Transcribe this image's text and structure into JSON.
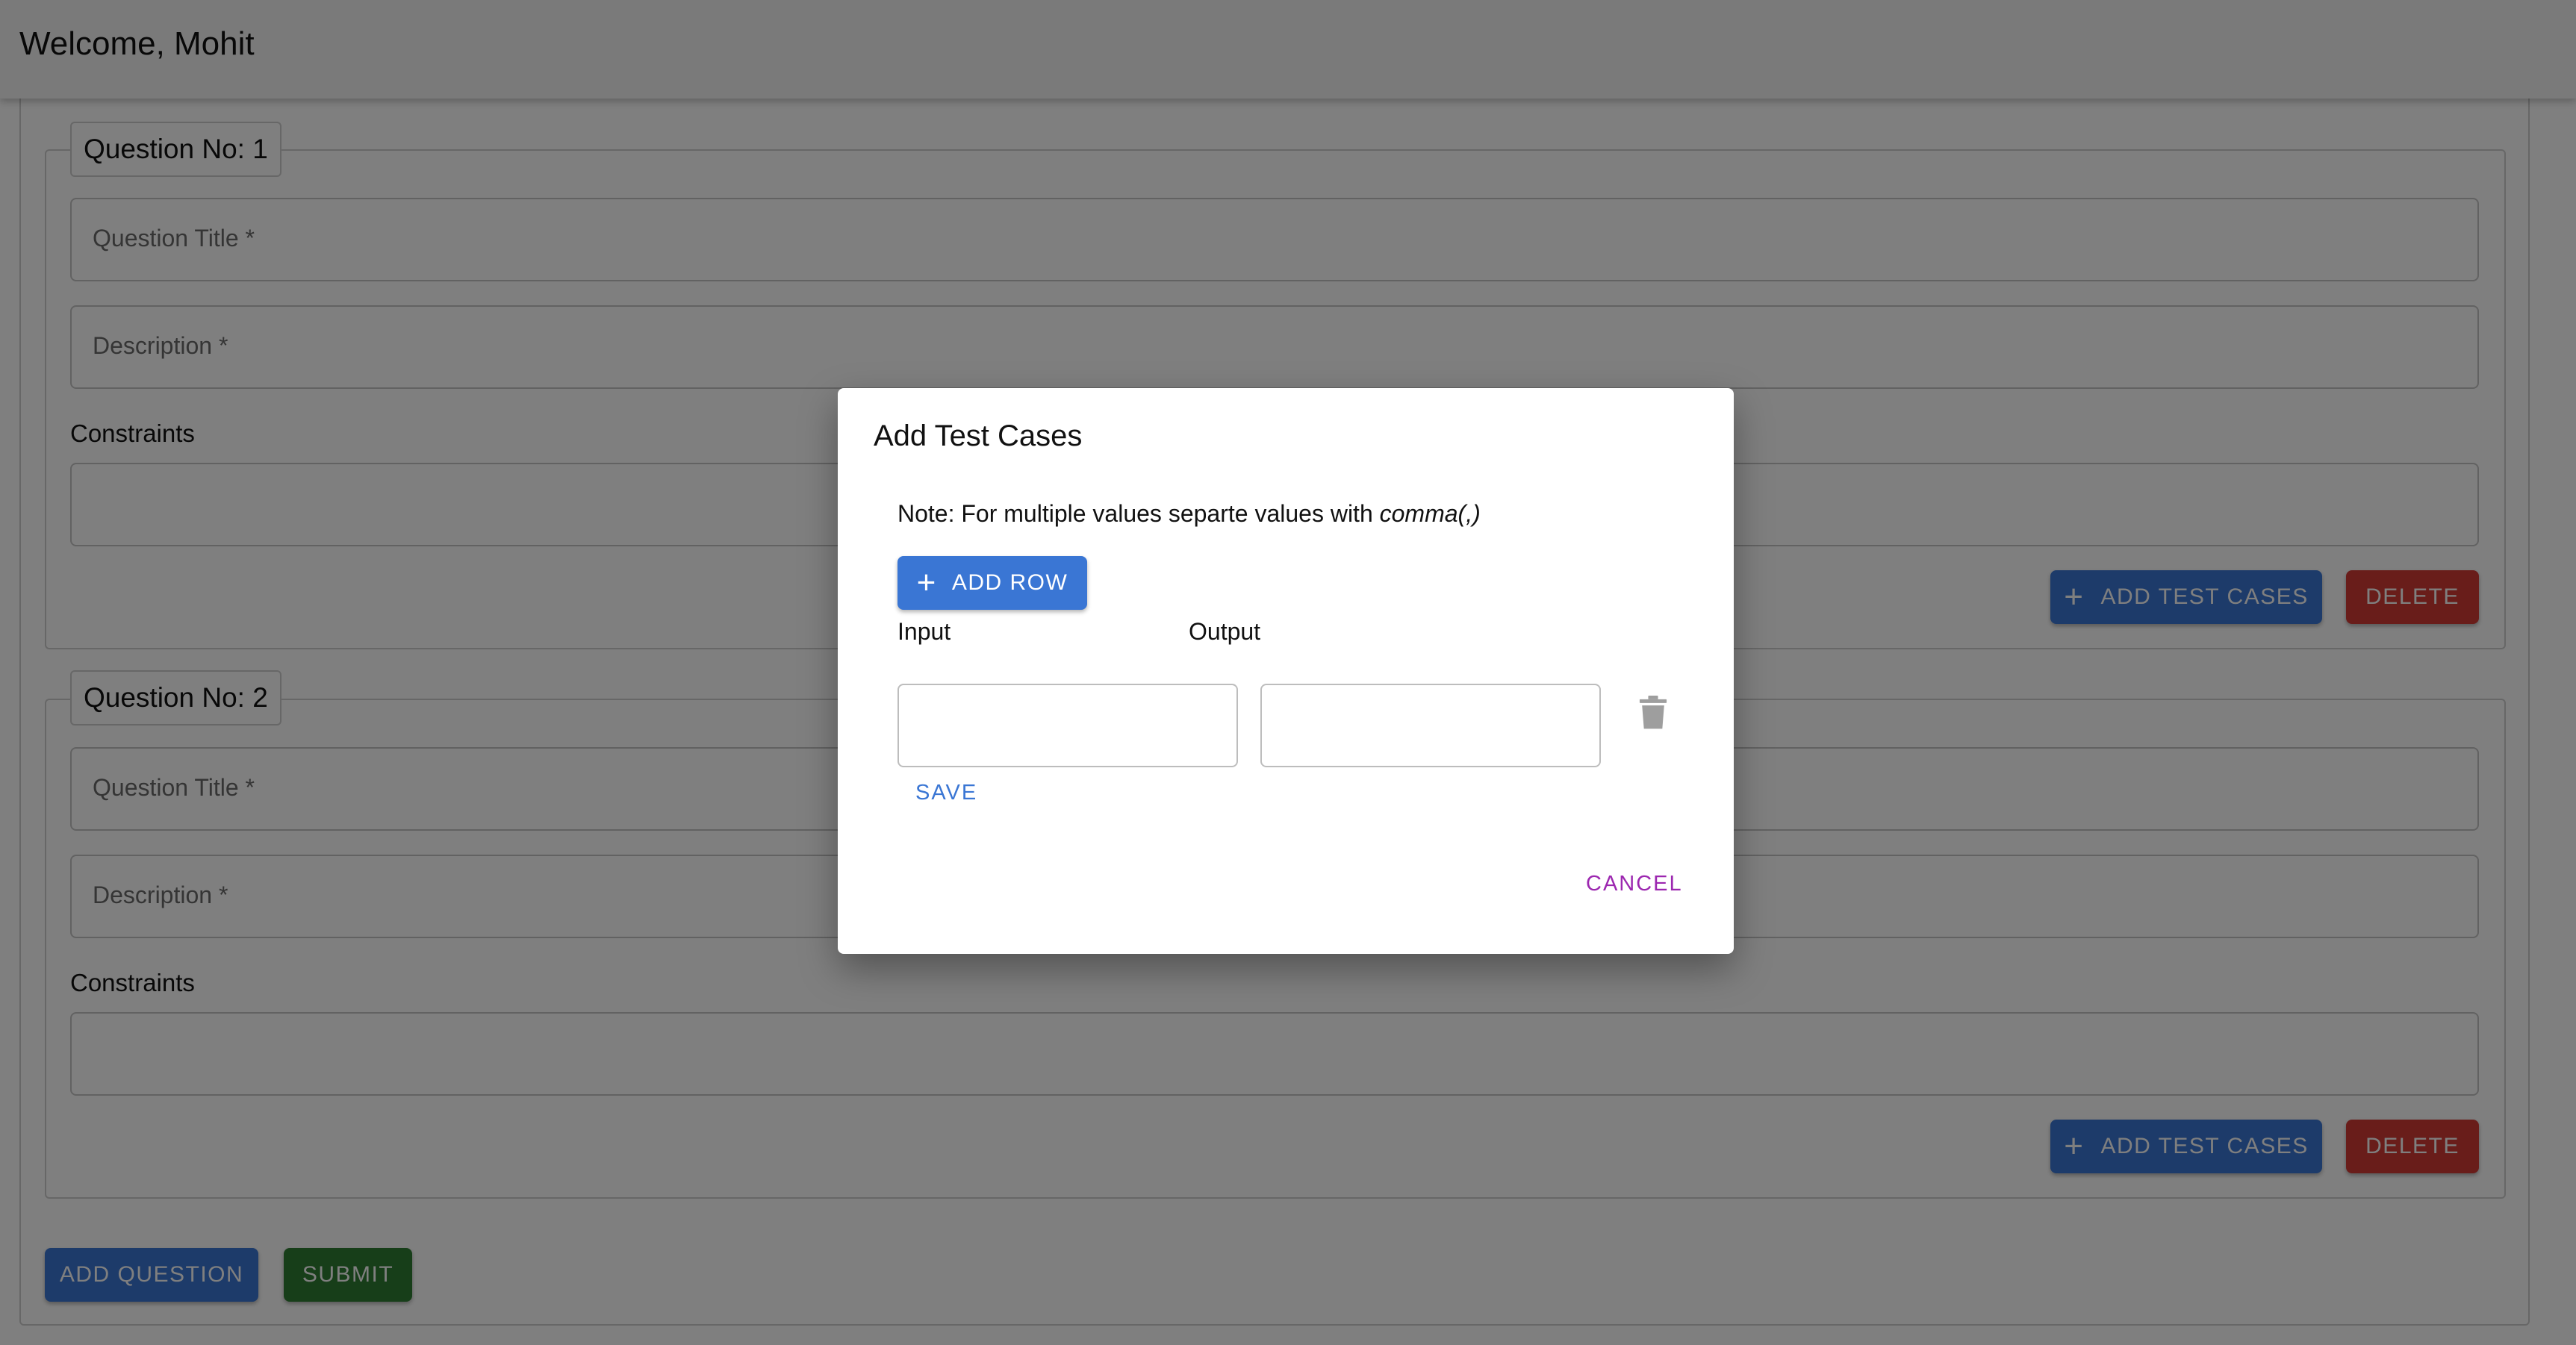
{
  "app_bar": {
    "title": "Welcome, Mohit"
  },
  "questions": [
    {
      "legend": "Question No: 1",
      "title_label": "Question Title *",
      "description_label": "Description *",
      "constraints_label": "Constraints",
      "add_test_cases_label": "ADD TEST CASES",
      "delete_label": "DELETE"
    },
    {
      "legend": "Question No: 2",
      "title_label": "Question Title *",
      "description_label": "Description *",
      "constraints_label": "Constraints",
      "add_test_cases_label": "ADD TEST CASES",
      "delete_label": "DELETE"
    }
  ],
  "footer": {
    "add_question_label": "ADD QUESTION",
    "submit_label": "SUBMIT"
  },
  "dialog": {
    "title": "Add Test Cases",
    "note_text": "Note: For multiple values separte values with ",
    "note_emphasis": "comma(,)",
    "add_row_label": "ADD ROW",
    "columns": {
      "input": "Input",
      "output": "Output"
    },
    "rows": [
      {
        "input": "",
        "output": ""
      }
    ],
    "save_label": "SAVE",
    "cancel_label": "CANCEL"
  },
  "icons": {
    "add": "plus-icon",
    "delete_row": "trash-icon"
  },
  "colors": {
    "primary": "#3a76d4",
    "danger": "#d23a35",
    "success": "#2e7d32",
    "cancel": "#9c27b0",
    "overlay": "rgba(0,0,0,0.5)"
  }
}
